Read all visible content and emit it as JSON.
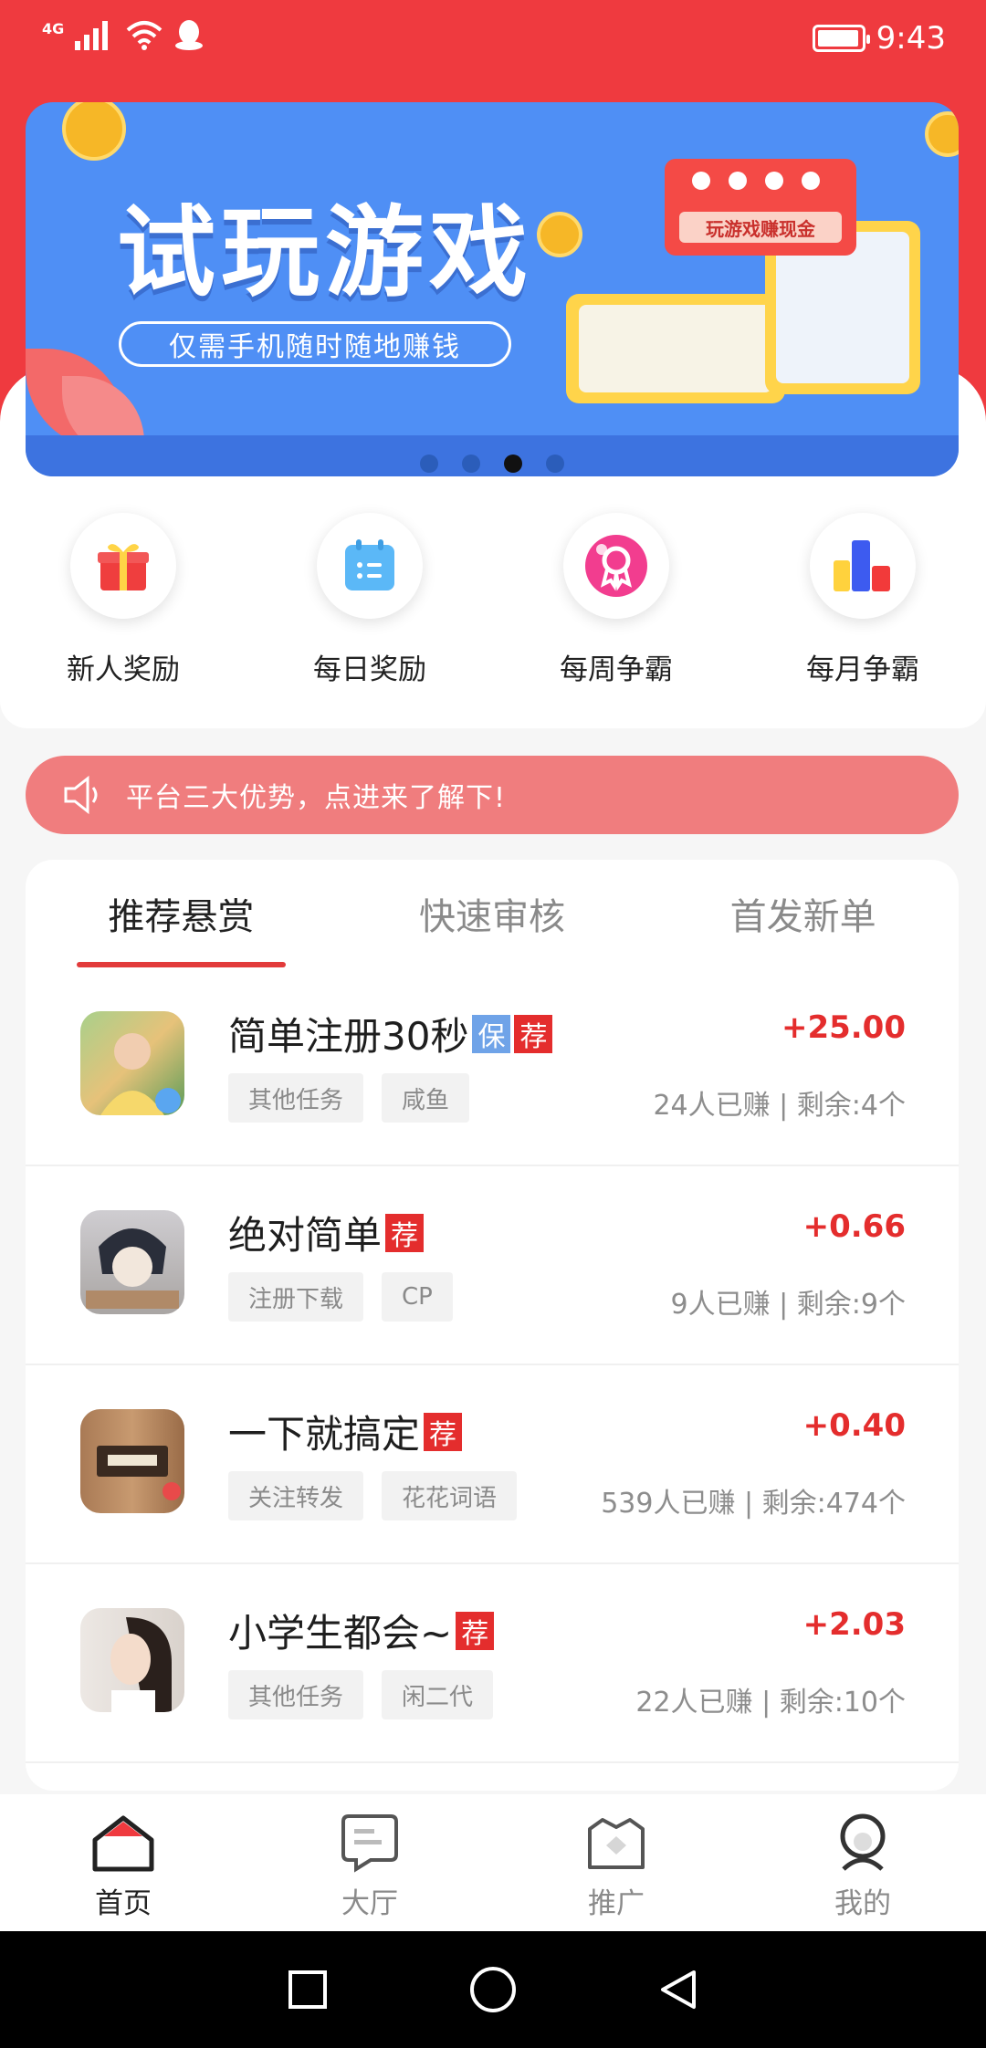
{
  "status_bar": {
    "network": "4G",
    "time": "9:43"
  },
  "banner": {
    "title": "试玩游戏",
    "subtitle": "仅需手机随时随地赚钱",
    "bubble_text": "玩游戏赚现金",
    "indicator_count": 4,
    "active_index": 2
  },
  "quick_actions": [
    {
      "label": "新人奖励",
      "icon": "gift-icon"
    },
    {
      "label": "每日奖励",
      "icon": "calendar-icon"
    },
    {
      "label": "每周争霸",
      "icon": "badge-icon"
    },
    {
      "label": "每月争霸",
      "icon": "bar-chart-icon"
    }
  ],
  "notice": {
    "text": "平台三大优势，点进来了解下!"
  },
  "tabs": [
    {
      "label": "推荐悬赏",
      "active": true
    },
    {
      "label": "快速审核",
      "active": false
    },
    {
      "label": "首发新单",
      "active": false
    }
  ],
  "tasks": [
    {
      "title": "简单注册30秒",
      "badges": [
        "保",
        "荐"
      ],
      "tags": [
        "其他任务",
        "咸鱼"
      ],
      "amount": "+25.00",
      "stats": "24人已赚 | 剩余:4个"
    },
    {
      "title": "绝对简单",
      "badges": [
        "荐"
      ],
      "tags": [
        "注册下载",
        "CP"
      ],
      "amount": "+0.66",
      "stats": "9人已赚 | 剩余:9个"
    },
    {
      "title": "一下就搞定",
      "badges": [
        "荐"
      ],
      "tags": [
        "关注转发",
        "花花词语"
      ],
      "amount": "+0.40",
      "stats": "539人已赚 | 剩余:474个"
    },
    {
      "title": "小学生都会~",
      "badges": [
        "荐"
      ],
      "tags": [
        "其他任务",
        "闲二代"
      ],
      "amount": "+2.03",
      "stats": "22人已赚 | 剩余:10个"
    }
  ],
  "bottom_nav": [
    {
      "label": "首页",
      "icon": "home-icon",
      "active": true
    },
    {
      "label": "大厅",
      "icon": "hall-icon",
      "active": false
    },
    {
      "label": "推广",
      "icon": "promote-icon",
      "active": false
    },
    {
      "label": "我的",
      "icon": "profile-icon",
      "active": false
    }
  ],
  "colors": {
    "brand_red": "#ef3a3f",
    "amount_red": "#e42d2d",
    "banner_blue": "#4f8ff5",
    "notice_pink": "#f07d7e"
  }
}
